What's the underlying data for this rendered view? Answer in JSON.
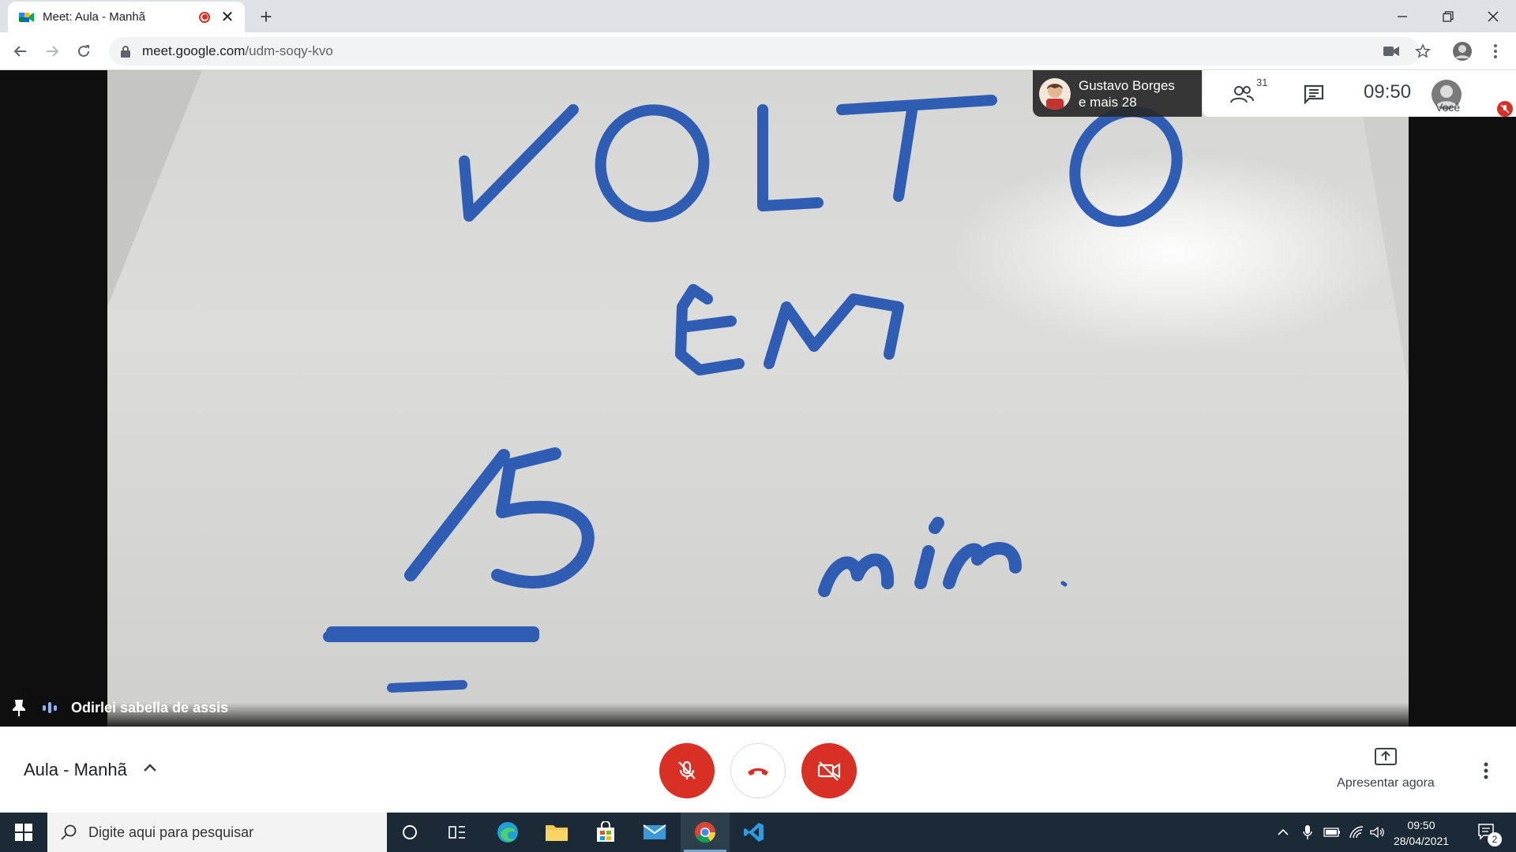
{
  "browser": {
    "tab": {
      "title": "Meet: Aula - Manhã",
      "recording": true
    },
    "address": {
      "host": "meet.google.com",
      "path": "/udm-soqy-kvo"
    }
  },
  "meet": {
    "participants_chip": {
      "name": "Gustavo Borges",
      "more": "e mais 28"
    },
    "participants_count": "31",
    "clock": "09:50",
    "self_label": "Você",
    "speaker_name": "Odirlei sabella de assis",
    "meeting_title": "Aula - Manhã",
    "present_label": "Apresentar agora",
    "whiteboard_text": [
      "VOLTO",
      "EM",
      "15",
      "min"
    ]
  },
  "taskbar": {
    "search_placeholder": "Digite aqui para pesquisar",
    "time": "09:50",
    "date": "28/04/2021",
    "notification_count": "2"
  },
  "colors": {
    "meet_red": "#d93025",
    "marker_blue": "#2f5db3",
    "taskbar": "#1b2a36"
  }
}
